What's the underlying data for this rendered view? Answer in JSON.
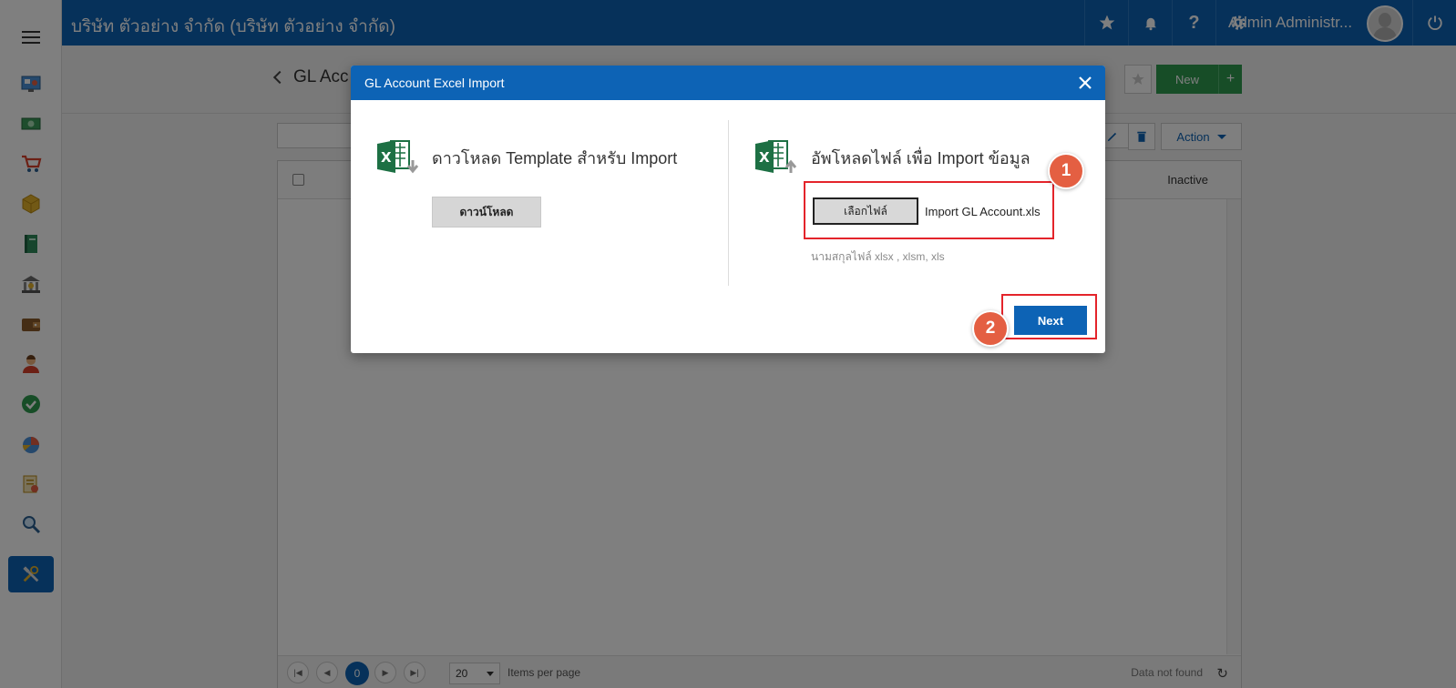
{
  "header": {
    "company": "บริษัท ตัวอย่าง จำกัด (บริษัท ตัวอย่าง จำกัด)",
    "user": "Admin Administr...",
    "icons": [
      "star-icon",
      "bell-icon",
      "help-icon",
      "gear-icon",
      "power-icon"
    ]
  },
  "sidebar": {
    "items": [
      "dashboard-icon",
      "money-icon",
      "cart-icon",
      "box-icon",
      "book-icon",
      "bank-icon",
      "wallet-icon",
      "people-icon",
      "approve-icon",
      "report-icon",
      "document-icon",
      "search-icon",
      "tools-icon"
    ]
  },
  "page": {
    "title": "GL Acc",
    "new_label": "New",
    "new_plus": "+",
    "action_label": "Action",
    "grid": {
      "column_inactive": "Inactive",
      "current_page": "0",
      "page_size": "20",
      "items_per_page": "Items per page",
      "status": "Data not found"
    }
  },
  "modal": {
    "title": "GL Account Excel Import",
    "download": {
      "heading": "ดาวโหลด Template สำหรับ Import",
      "button": "ดาวน์โหลด"
    },
    "upload": {
      "heading": "อัพโหลดไฟล์ เพื่อ Import ข้อมูล",
      "choose_button": "เลือกไฟล์",
      "file_name": "Import GL Account.xls",
      "hint": "นามสกุลไฟล์ xlsx , xlsm, xls"
    },
    "next_button": "Next"
  },
  "steps": [
    "1",
    "2"
  ],
  "colors": {
    "primary": "#0d63b5",
    "success": "#2e9a4f",
    "highlight": "#e4242b",
    "badge": "#e45f42",
    "excel": "#1d7044"
  }
}
